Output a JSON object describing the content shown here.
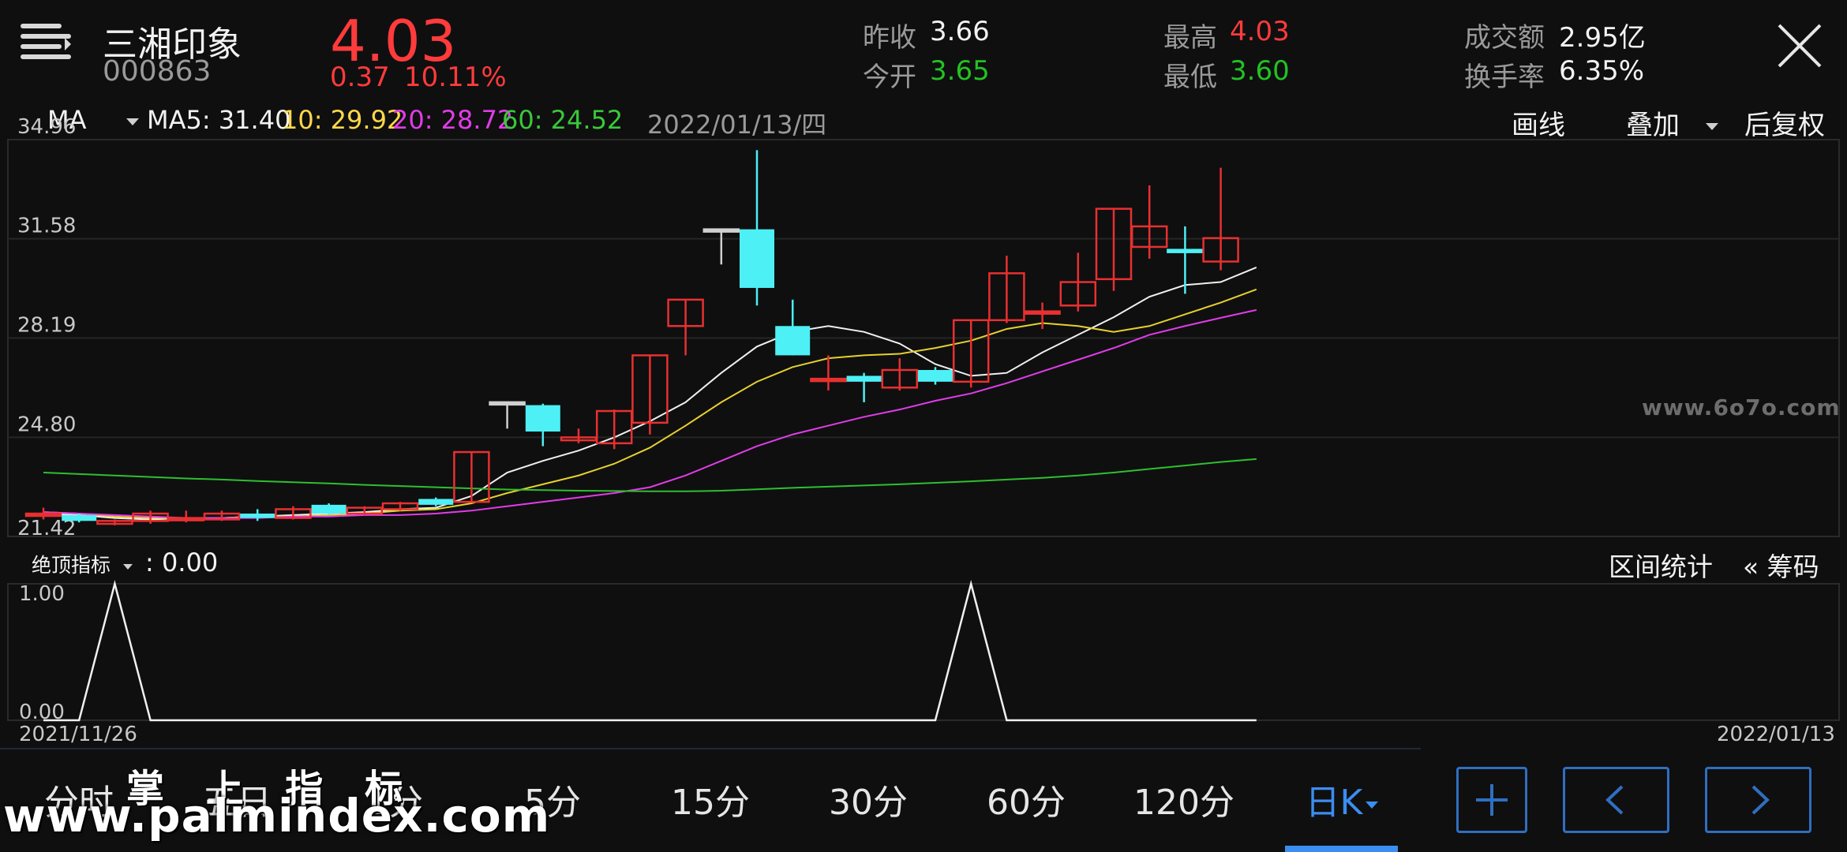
{
  "header": {
    "stock_name": "三湘印象",
    "stock_code": "000863",
    "price": "4.03",
    "change": "0.37",
    "change_pct": "10.11%",
    "stats": [
      {
        "label": "昨收",
        "value": "3.66",
        "color": "#e6e6e6"
      },
      {
        "label": "今开",
        "value": "3.65",
        "color": "#22c222"
      },
      {
        "label": "最高",
        "value": "4.03",
        "color": "#ff3b3b"
      },
      {
        "label": "最低",
        "value": "3.60",
        "color": "#22c222"
      },
      {
        "label": "成交额",
        "value": "2.95亿",
        "color": "#f2f2f2"
      },
      {
        "label": "换手率",
        "value": "6.35%",
        "color": "#f2f2f2"
      }
    ]
  },
  "ma_bar": {
    "indicator": "MA",
    "ma5": "MA5: 31.40",
    "ma10": "10: 29.92",
    "ma20": "20: 28.72",
    "ma60": "60: 24.52",
    "date": "2022/01/13/四",
    "draw_line": "画线",
    "overlay": "叠加",
    "adjust": "后复权"
  },
  "main_chart": {
    "y_ticks": [
      "34.96",
      "31.58",
      "28.19",
      "24.80",
      "21.42"
    ],
    "y_max": 34.96,
    "y_min": 21.42,
    "candles": [
      {
        "o": 22.2,
        "c": 22.2,
        "h": 22.4,
        "l": 22.0,
        "dir": "flat"
      },
      {
        "o": 22.15,
        "c": 21.95,
        "h": 22.2,
        "l": 21.9,
        "dir": "down"
      },
      {
        "o": 21.95,
        "c": 21.85,
        "h": 22.0,
        "l": 21.8,
        "dir": "up"
      },
      {
        "o": 21.95,
        "c": 22.2,
        "h": 22.3,
        "l": 21.85,
        "dir": "up"
      },
      {
        "o": 22.05,
        "c": 22.05,
        "h": 22.3,
        "l": 21.9,
        "dir": "flat"
      },
      {
        "o": 22.0,
        "c": 22.2,
        "h": 22.3,
        "l": 21.95,
        "dir": "up"
      },
      {
        "o": 22.2,
        "c": 22.05,
        "h": 22.35,
        "l": 21.95,
        "dir": "down"
      },
      {
        "o": 22.05,
        "c": 22.35,
        "h": 22.45,
        "l": 22.0,
        "dir": "up"
      },
      {
        "o": 22.5,
        "c": 22.2,
        "h": 22.55,
        "l": 22.15,
        "dir": "down"
      },
      {
        "o": 22.2,
        "c": 22.4,
        "h": 22.45,
        "l": 22.15,
        "dir": "up"
      },
      {
        "o": 22.35,
        "c": 22.55,
        "h": 22.6,
        "l": 22.3,
        "dir": "up"
      },
      {
        "o": 22.7,
        "c": 22.5,
        "h": 22.75,
        "l": 22.45,
        "dir": "down"
      },
      {
        "o": 22.6,
        "c": 24.3,
        "h": 24.3,
        "l": 22.6,
        "dir": "up"
      },
      {
        "o": 26.0,
        "c": 26.0,
        "h": 26.0,
        "l": 25.1,
        "dir": "flat"
      },
      {
        "o": 25.9,
        "c": 25.0,
        "h": 25.95,
        "l": 24.5,
        "dir": "down"
      },
      {
        "o": 24.7,
        "c": 24.8,
        "h": 25.1,
        "l": 24.6,
        "dir": "up"
      },
      {
        "o": 24.6,
        "c": 25.7,
        "h": 25.75,
        "l": 24.4,
        "dir": "up"
      },
      {
        "o": 25.3,
        "c": 27.6,
        "h": 27.6,
        "l": 24.9,
        "dir": "up"
      },
      {
        "o": 28.6,
        "c": 29.5,
        "h": 29.5,
        "l": 27.6,
        "dir": "up"
      },
      {
        "o": 31.9,
        "c": 31.9,
        "h": 31.9,
        "l": 30.7,
        "dir": "flat"
      },
      {
        "o": 31.9,
        "c": 29.9,
        "h": 34.6,
        "l": 29.3,
        "dir": "down"
      },
      {
        "o": 28.6,
        "c": 27.6,
        "h": 29.5,
        "l": 27.6,
        "dir": "down"
      },
      {
        "o": 26.8,
        "c": 26.8,
        "h": 27.6,
        "l": 26.4,
        "dir": "flat"
      },
      {
        "o": 26.9,
        "c": 26.7,
        "h": 27.0,
        "l": 26.0,
        "dir": "down"
      },
      {
        "o": 26.5,
        "c": 27.1,
        "h": 27.5,
        "l": 26.4,
        "dir": "up"
      },
      {
        "o": 27.1,
        "c": 26.7,
        "h": 27.2,
        "l": 26.6,
        "dir": "down"
      },
      {
        "o": 26.7,
        "c": 28.8,
        "h": 28.8,
        "l": 26.5,
        "dir": "up"
      },
      {
        "o": 28.8,
        "c": 30.4,
        "h": 31.0,
        "l": 28.7,
        "dir": "up"
      },
      {
        "o": 29.1,
        "c": 29.1,
        "h": 29.4,
        "l": 28.5,
        "dir": "flat"
      },
      {
        "o": 29.3,
        "c": 30.1,
        "h": 31.1,
        "l": 29.1,
        "dir": "up"
      },
      {
        "o": 30.2,
        "c": 32.6,
        "h": 32.6,
        "l": 29.8,
        "dir": "up"
      },
      {
        "o": 31.3,
        "c": 32.0,
        "h": 33.4,
        "l": 30.9,
        "dir": "up"
      },
      {
        "o": 31.2,
        "c": 31.2,
        "h": 32.0,
        "l": 29.7,
        "dir": "flat"
      },
      {
        "o": 30.8,
        "c": 31.6,
        "h": 34.0,
        "l": 30.5,
        "dir": "up"
      }
    ],
    "ma_lines": [
      {
        "name": "MA5",
        "color": "#f0f0f0",
        "values": [
          22.2,
          22.15,
          22.05,
          22.0,
          22.05,
          22.05,
          22.1,
          22.15,
          22.2,
          22.25,
          22.35,
          22.4,
          22.8,
          23.6,
          24.0,
          24.35,
          24.8,
          25.35,
          26.0,
          27.0,
          27.9,
          28.4,
          28.6,
          28.4,
          28.0,
          27.3,
          26.9,
          27.0,
          27.7,
          28.3,
          28.9,
          29.6,
          30.0,
          30.1,
          30.6
        ]
      },
      {
        "name": "MA10",
        "color": "#e6d12c",
        "values": [
          22.25,
          22.2,
          22.1,
          22.05,
          22.05,
          22.05,
          22.1,
          22.1,
          22.15,
          22.2,
          22.3,
          22.35,
          22.55,
          22.9,
          23.2,
          23.5,
          23.9,
          24.45,
          25.2,
          26.0,
          26.7,
          27.2,
          27.5,
          27.6,
          27.65,
          27.85,
          28.1,
          28.5,
          28.7,
          28.6,
          28.4,
          28.6,
          29.0,
          29.4,
          29.85
        ]
      },
      {
        "name": "MA20",
        "color": "#e23ce8",
        "values": [
          22.25,
          22.2,
          22.15,
          22.1,
          22.05,
          22.05,
          22.05,
          22.1,
          22.1,
          22.15,
          22.15,
          22.2,
          22.3,
          22.45,
          22.6,
          22.75,
          22.9,
          23.1,
          23.5,
          24.0,
          24.5,
          24.9,
          25.2,
          25.5,
          25.75,
          26.05,
          26.3,
          26.65,
          27.05,
          27.45,
          27.85,
          28.3,
          28.6,
          28.88,
          29.15
        ]
      },
      {
        "name": "MA60",
        "color": "#2fbf2f",
        "values": [
          23.6,
          23.55,
          23.5,
          23.45,
          23.4,
          23.36,
          23.31,
          23.27,
          23.23,
          23.18,
          23.14,
          23.1,
          23.06,
          23.02,
          23.0,
          22.98,
          22.97,
          22.96,
          22.96,
          22.98,
          23.03,
          23.08,
          23.12,
          23.16,
          23.2,
          23.25,
          23.3,
          23.36,
          23.42,
          23.5,
          23.6,
          23.72,
          23.84,
          23.96,
          24.06
        ]
      }
    ]
  },
  "sub_chart": {
    "indicator": "绝顶指标",
    "value_label": ": 0.00",
    "y_top": "1.00",
    "y_bottom": "0.00",
    "values": [
      0,
      0,
      1,
      0,
      0,
      0,
      0,
      0,
      0,
      0,
      0,
      0,
      0,
      0,
      0,
      0,
      0,
      0,
      0,
      0,
      0,
      0,
      0,
      0,
      0,
      0,
      1,
      0,
      0,
      0,
      0,
      0,
      0,
      0,
      0
    ],
    "interval_stats": "区间统计",
    "chips": "« 筹码",
    "date_start": "2021/11/26",
    "date_end": "2022/01/13"
  },
  "tabs": [
    "分时",
    "五日",
    "1分",
    "5分",
    "15分",
    "30分",
    "60分",
    "120分",
    "日K"
  ],
  "active_tab": "日K",
  "watermark_text": "www.palmindex.com",
  "watermark_chinese": "掌 上 指 标",
  "site_watermark": "www.6o7o.com",
  "colors": {
    "up": "#e83030",
    "down": "#4df0f5",
    "accent": "#3b8df0"
  }
}
